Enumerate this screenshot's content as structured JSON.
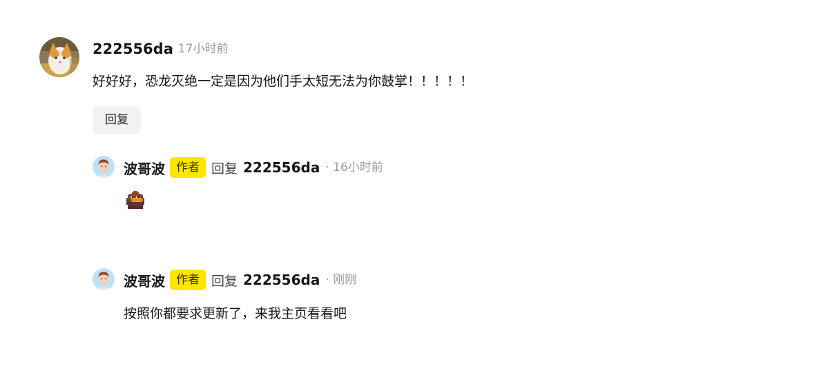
{
  "main_comment": {
    "username": "222556da",
    "time": "· 17小时前",
    "text": "好好好，恐龙灭绝一定是因为他们手太短无法为你鼓掌！！！！！",
    "avatar_icon": "cat-photo-avatar",
    "reply_label": "回复"
  },
  "replies": [
    {
      "username": "波哥波",
      "badge": "作者",
      "reply_verb": "回复",
      "reply_to": "222556da",
      "time": "· 16小时前",
      "content_type": "sticker",
      "sticker_icon": "pixel-bird-sticker",
      "avatar_icon": "cartoon-boy-avatar"
    },
    {
      "username": "波哥波",
      "badge": "作者",
      "reply_verb": "回复",
      "reply_to": "222556da",
      "time": "· 刚刚",
      "text": "按照你都要求更新了，来我主页看看吧",
      "avatar_icon": "cartoon-boy-avatar"
    }
  ],
  "colors": {
    "badge_bg": "#ffe600",
    "reply_button_bg": "#f2f2f2",
    "meta_text": "#9b9b9b",
    "avatar_bg": "#bfe0f5"
  }
}
